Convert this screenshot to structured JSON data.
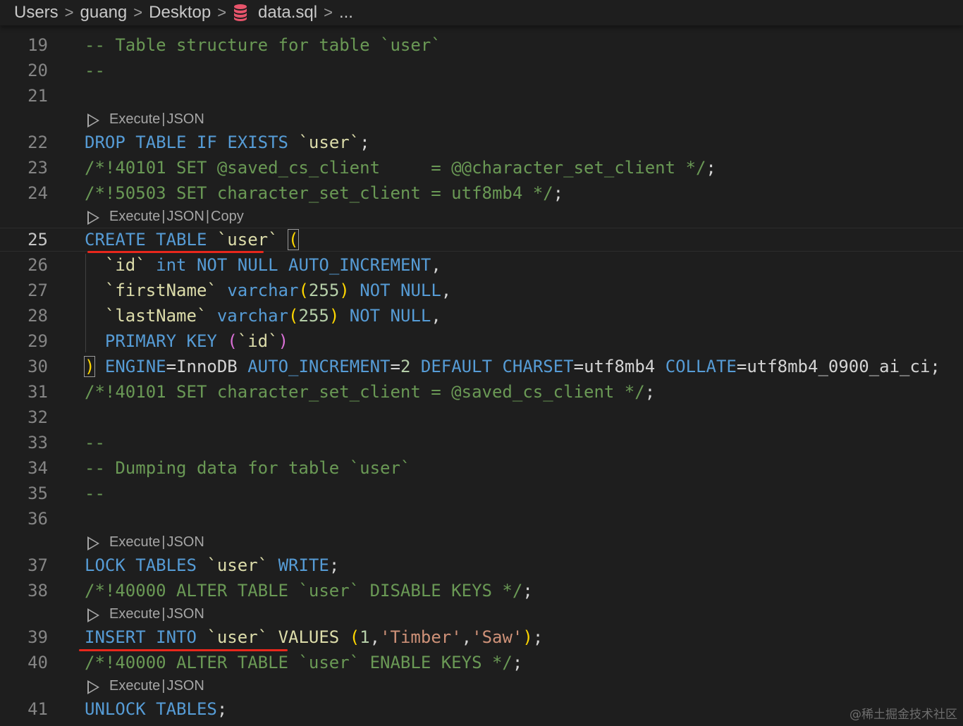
{
  "breadcrumb": {
    "items": [
      "Users",
      "guang",
      "Desktop",
      "data.sql",
      "..."
    ],
    "separator": ">"
  },
  "code_lens": {
    "execute": "Execute",
    "json": "JSON",
    "copy": "Copy",
    "separator": "|"
  },
  "editor": {
    "active_line": "25",
    "lines": {
      "19": "-- Table structure for table `user`",
      "20": "--",
      "21": "",
      "22": "DROP TABLE IF EXISTS `user`;",
      "23": "/*!40101 SET @saved_cs_client     = @@character_set_client */;",
      "24": "/*!50503 SET character_set_client = utf8mb4 */;",
      "25": "CREATE TABLE `user` (",
      "26": "  `id` int NOT NULL AUTO_INCREMENT,",
      "27": "  `firstName` varchar(255) NOT NULL,",
      "28": "  `lastName` varchar(255) NOT NULL,",
      "29": "  PRIMARY KEY (`id`)",
      "30": ") ENGINE=InnoDB AUTO_INCREMENT=2 DEFAULT CHARSET=utf8mb4 COLLATE=utf8mb4_0900_ai_ci;",
      "31": "/*!40101 SET character_set_client = @saved_cs_client */;",
      "32": "",
      "33": "--",
      "34": "-- Dumping data for table `user`",
      "35": "--",
      "36": "",
      "37": "LOCK TABLES `user` WRITE;",
      "38": "/*!40000 ALTER TABLE `user` DISABLE KEYS */;",
      "39": "INSERT INTO `user` VALUES (1,'Timber','Saw');",
      "40": "/*!40000 ALTER TABLE `user` ENABLE KEYS */;",
      "41": "UNLOCK TABLES;"
    }
  },
  "tokens": {
    "drop": "DROP",
    "table": "TABLE",
    "if": "IF",
    "exists": "EXISTS",
    "user_q": "`user`",
    "semi": ";",
    "c23_set": "/*!40101 SET @saved_cs_client     = @@character_set_client */",
    "c24": "/*!50503 SET character_set_client = utf8mb4 */",
    "create": "CREATE",
    "paren_open": "(",
    "paren_close": ")",
    "id_q": "`id`",
    "int": "int",
    "not": "NOT",
    "null": "NULL",
    "auto_increment": "AUTO_INCREMENT",
    "comma": ",",
    "firstname_q": "`firstName`",
    "lastname_q": "`lastName`",
    "varchar": "varchar",
    "n255": "255",
    "primary": "PRIMARY",
    "key": "KEY",
    "engine": "ENGINE",
    "eq": "=",
    "innodb": "InnoDB",
    "n2": "2",
    "default": "DEFAULT",
    "charset": "CHARSET",
    "utf8mb4": "utf8mb4",
    "collate": "COLLATE",
    "collation": "utf8mb4_0900_ai_ci",
    "c31": "/*!40101 SET character_set_client = @saved_cs_client */",
    "lock": "LOCK",
    "tables": "TABLES",
    "write": "WRITE",
    "c38": "/*!40000 ALTER TABLE `user` DISABLE KEYS */",
    "insert": "INSERT",
    "into": "INTO",
    "values": "VALUES",
    "n1": "1",
    "timber": "'Timber'",
    "saw": "'Saw'",
    "c40": "/*!40000 ALTER TABLE `user` ENABLE KEYS */",
    "unlock": "UNLOCK"
  },
  "watermark": "@稀土掘金技术社区",
  "colors": {
    "background": "#1e1e1e",
    "keyword": "#569cd6",
    "comment": "#6a9955",
    "string": "#ce9178",
    "number": "#b5cea8",
    "identifier": "#dcdcaa",
    "bracket": "#ffd700",
    "annotation_underline": "#e8271c",
    "sql_file_icon": "#e8546b"
  }
}
